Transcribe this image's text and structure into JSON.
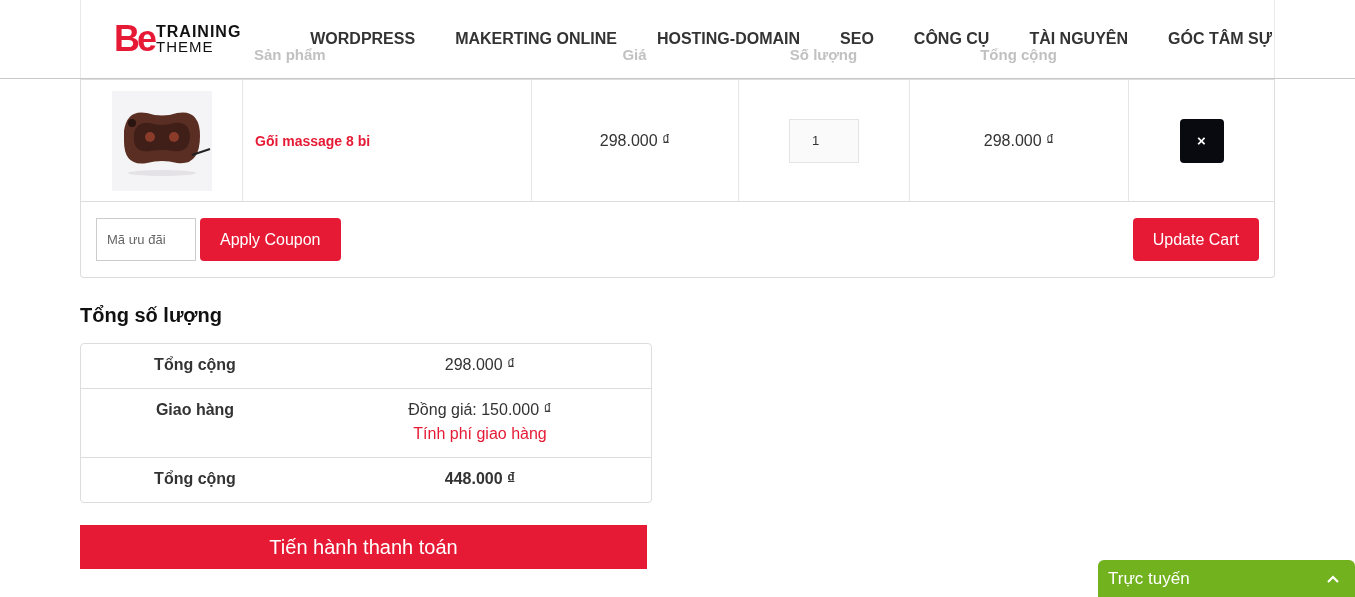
{
  "logo": {
    "mark": "Be",
    "line1": "TRAINING",
    "line2": "THEME"
  },
  "nav": [
    "WORDPRESS",
    "MAKERTING ONLINE",
    "HOSTING-DOMAIN",
    "SEO",
    "CÔNG CỤ",
    "TÀI NGUYÊN",
    "GÓC TÂM SỰ"
  ],
  "cart": {
    "columns": [
      "Sản phẩm",
      "Giá",
      "Số lượng",
      "Tổng cộng"
    ],
    "rows": [
      {
        "kind": "picture",
        "name": "Gối massage 8 bi",
        "price": "298.000 ₫",
        "quantity": "1",
        "subtotal": "298.000 ₫",
        "remove": "×"
      }
    ],
    "coupon": {
      "placeholder": "Mã ưu đãi",
      "apply": "Apply Coupon"
    },
    "update": "Update Cart"
  },
  "totals": {
    "title": "Tổng số lượng",
    "rows": [
      {
        "label": "Tổng cộng",
        "value": "298.000 ₫",
        "bold": false
      },
      {
        "label": "Giao hàng",
        "value": "Đồng giá: 150.000 ₫",
        "link": "Tính phí giao hàng",
        "bold": false
      },
      {
        "label": "Tổng cộng",
        "value": "448.000 ₫",
        "bold": true
      }
    ],
    "checkout": "Tiến hành thanh toán"
  },
  "chat": {
    "label": "Trực tuyến",
    "expanded": false
  }
}
